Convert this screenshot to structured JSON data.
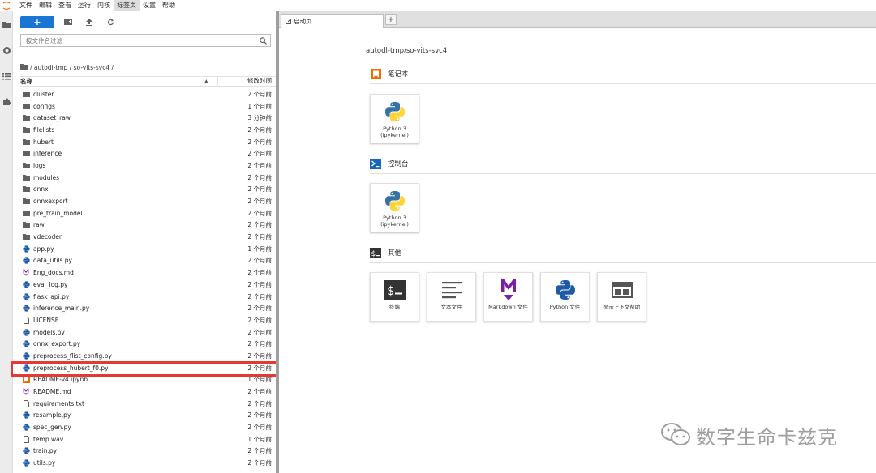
{
  "menubar": {
    "items": [
      "文件",
      "编辑",
      "查看",
      "运行",
      "内核",
      "标签页",
      "设置",
      "帮助"
    ],
    "active_index": 5
  },
  "activity_icons": [
    "folder-icon",
    "running-circle-icon",
    "list-icon",
    "puzzle-icon"
  ],
  "file_browser": {
    "new_button_label": "+",
    "search_placeholder": "按文件名过滤",
    "breadcrumb": "/ autodl-tmp / so-vits-svc4 /",
    "header_name": "名称",
    "header_sort": "▲",
    "header_modified": "修改时间",
    "files": [
      {
        "name": "cluster",
        "modified": "2 个月前",
        "type": "folder"
      },
      {
        "name": "configs",
        "modified": "1 个月前",
        "type": "folder"
      },
      {
        "name": "dataset_raw",
        "modified": "3 分钟前",
        "type": "folder"
      },
      {
        "name": "filelists",
        "modified": "2 个月前",
        "type": "folder"
      },
      {
        "name": "hubert",
        "modified": "2 个月前",
        "type": "folder"
      },
      {
        "name": "inference",
        "modified": "2 个月前",
        "type": "folder"
      },
      {
        "name": "logs",
        "modified": "2 个月前",
        "type": "folder"
      },
      {
        "name": "modules",
        "modified": "2 个月前",
        "type": "folder"
      },
      {
        "name": "onnx",
        "modified": "2 个月前",
        "type": "folder"
      },
      {
        "name": "onnxexport",
        "modified": "2 个月前",
        "type": "folder"
      },
      {
        "name": "pre_train_model",
        "modified": "2 个月前",
        "type": "folder"
      },
      {
        "name": "raw",
        "modified": "2 个月前",
        "type": "folder"
      },
      {
        "name": "vdecoder",
        "modified": "2 个月前",
        "type": "folder"
      },
      {
        "name": "app.py",
        "modified": "1 个月前",
        "type": "python"
      },
      {
        "name": "data_utils.py",
        "modified": "2 个月前",
        "type": "python"
      },
      {
        "name": "Eng_docs.md",
        "modified": "2 个月前",
        "type": "markdown"
      },
      {
        "name": "eval_log.py",
        "modified": "2 个月前",
        "type": "python"
      },
      {
        "name": "flask_api.py",
        "modified": "2 个月前",
        "type": "python"
      },
      {
        "name": "inference_main.py",
        "modified": "2 个月前",
        "type": "python"
      },
      {
        "name": "LICENSE",
        "modified": "2 个月前",
        "type": "text"
      },
      {
        "name": "models.py",
        "modified": "2 个月前",
        "type": "python"
      },
      {
        "name": "onnx_export.py",
        "modified": "2 个月前",
        "type": "python"
      },
      {
        "name": "preprocess_flist_config.py",
        "modified": "2 个月前",
        "type": "python"
      },
      {
        "name": "preprocess_hubert_f0.py",
        "modified": "2 个月前",
        "type": "python"
      },
      {
        "name": "README-v4.ipynb",
        "modified": "1 个月前",
        "type": "notebook"
      },
      {
        "name": "README.md",
        "modified": "2 个月前",
        "type": "markdown"
      },
      {
        "name": "requirements.txt",
        "modified": "2 个月前",
        "type": "text"
      },
      {
        "name": "resample.py",
        "modified": "2 个月前",
        "type": "python"
      },
      {
        "name": "spec_gen.py",
        "modified": "2 个月前",
        "type": "python"
      },
      {
        "name": "temp.wav",
        "modified": "1 个月前",
        "type": "audio"
      },
      {
        "name": "train.py",
        "modified": "2 个月前",
        "type": "python"
      },
      {
        "name": "utils.py",
        "modified": "2 个月前",
        "type": "python"
      }
    ]
  },
  "tabs": {
    "launcher_tab": "启动页",
    "add_tab": "+"
  },
  "launcher": {
    "path": "autodl-tmp/so-vits-svc4",
    "sections": {
      "notebook": {
        "title": "笔记本",
        "cards": [
          {
            "label": "Python 3 (ipykernel)",
            "icon": "python-logo-icon"
          }
        ]
      },
      "console": {
        "title": "控制台",
        "cards": [
          {
            "label": "Python 3 (ipykernel)",
            "icon": "python-logo-icon"
          }
        ]
      },
      "other": {
        "title": "其他",
        "cards": [
          {
            "label": "终端",
            "icon": "terminal-icon"
          },
          {
            "label": "文本文件",
            "icon": "text-file-icon"
          },
          {
            "label": "Markdown 文件",
            "icon": "markdown-icon"
          },
          {
            "label": "Python 文件",
            "icon": "python-logo-icon"
          },
          {
            "label": "显示上下文帮助",
            "icon": "context-help-icon"
          }
        ]
      }
    }
  },
  "watermark": "数字生命卡兹克",
  "colors": {
    "accent_blue": "#1976d2",
    "notebook_orange": "#ef6c00",
    "console_blue": "#1565c0",
    "markdown_purple": "#7b1fa2",
    "highlight_red": "#e53935"
  }
}
